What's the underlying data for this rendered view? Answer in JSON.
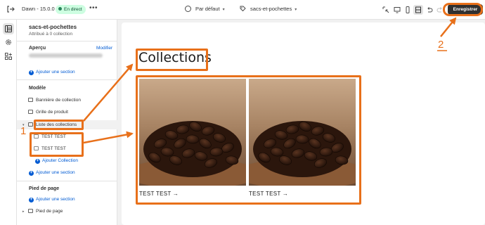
{
  "topbar": {
    "theme_name": "Dawn - 15.0.0",
    "status_badge": "En direct",
    "more_label": "•••",
    "template_select": "Par défaut",
    "page_select": "sacs-et-pochettes",
    "save_label": "Enregistrer"
  },
  "sidebar": {
    "title": "sacs-et-pochettes",
    "subtitle": "Attribué à 0 collection",
    "preview_label": "Aperçu",
    "modify_label": "Modifier",
    "add_section_label": "Ajouter une section",
    "template_heading": "Modèle",
    "items": [
      {
        "label": "Bannière de collection"
      },
      {
        "label": "Grille de produit"
      },
      {
        "label": "Liste des collections"
      }
    ],
    "sub_items": [
      {
        "label": "TEST TEST"
      },
      {
        "label": "TEST TEST"
      }
    ],
    "add_collection_label": "Ajouter Collection",
    "add_section_label_2": "Ajouter une section",
    "footer_heading": "Pied de page",
    "add_section_label_3": "Ajouter une section",
    "footer_item": "Pied de page"
  },
  "preview": {
    "heading": "Collections",
    "cards": [
      {
        "label": "TEST TEST →"
      },
      {
        "label": "TEST TEST →"
      }
    ]
  },
  "annotations": {
    "num_1": "1",
    "num_2": "2"
  },
  "colors": {
    "accent": "#e8701a",
    "link": "#005bd3",
    "save_bg": "#303030",
    "badge_bg": "#cdfee1"
  }
}
